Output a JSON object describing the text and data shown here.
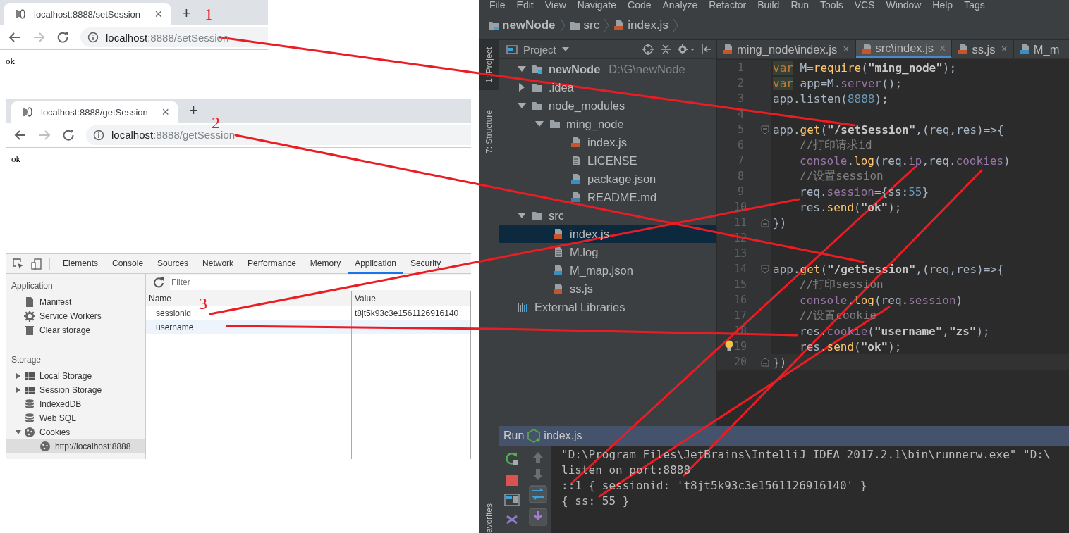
{
  "browsers": [
    {
      "tab": {
        "title": "localhost:8888/setSession",
        "close": "×"
      },
      "new_tab": "+",
      "url": {
        "host": "localhost",
        "rest": ":8888/setSession"
      },
      "content": "ok"
    },
    {
      "tab": {
        "title": "localhost:8888/getSession",
        "close": "×"
      },
      "new_tab": "+",
      "url": {
        "host": "localhost",
        "rest": ":8888/getSession"
      },
      "content": "ok"
    }
  ],
  "annotations": [
    "1",
    "2",
    "3"
  ],
  "devtools": {
    "tabs": [
      {
        "label": "Elements",
        "selected": false
      },
      {
        "label": "Console",
        "selected": false
      },
      {
        "label": "Sources",
        "selected": false
      },
      {
        "label": "Network",
        "selected": false
      },
      {
        "label": "Performance",
        "selected": false
      },
      {
        "label": "Memory",
        "selected": false
      },
      {
        "label": "Application",
        "selected": true
      },
      {
        "label": "Security",
        "selected": false
      }
    ],
    "sidebar": [
      {
        "heading": "Application",
        "items": [
          {
            "label": "Manifest",
            "kind": "manifest",
            "selected": false
          },
          {
            "label": "Service Workers",
            "kind": "gear",
            "selected": false
          },
          {
            "label": "Clear storage",
            "kind": "trash",
            "selected": false
          }
        ]
      },
      {
        "heading": "Storage",
        "items": [
          {
            "label": "Local Storage",
            "kind": "grid",
            "expanded": false,
            "selected": false
          },
          {
            "label": "Session Storage",
            "kind": "grid",
            "expanded": false,
            "selected": false
          },
          {
            "label": "IndexedDB",
            "kind": "database",
            "selected": false
          },
          {
            "label": "Web SQL",
            "kind": "database",
            "selected": false
          },
          {
            "label": "Cookies",
            "kind": "cookie",
            "expanded": true,
            "selected": false,
            "children": [
              {
                "label": "http://localhost:8888",
                "kind": "cookie",
                "selected": true
              }
            ]
          }
        ]
      }
    ],
    "filter": {
      "placeholder": "Filter"
    },
    "table": {
      "columns": [
        "Name",
        "Value"
      ],
      "rows": [
        {
          "name": "sessionid",
          "value": "t8jt5k93c3e1561126916140",
          "selected": false
        },
        {
          "name": "username",
          "selected": true
        }
      ]
    }
  },
  "ide": {
    "menu": [
      "File",
      "Edit",
      "View",
      "Navigate",
      "Code",
      "Analyze",
      "Refactor",
      "Build",
      "Run",
      "Tools",
      "VCS",
      "Window",
      "Help",
      "Tags"
    ],
    "breadcrumbs": [
      {
        "label": "newNode",
        "kind": "module"
      },
      {
        "label": "src",
        "kind": "folder"
      },
      {
        "label": "index.js",
        "kind": "js"
      }
    ],
    "tool_strip": [
      {
        "label": "1: Project",
        "selected": true
      },
      {
        "label": "7: Structure",
        "selected": false
      }
    ],
    "tool_strip_bottom": "avorites",
    "project": {
      "title": "Project",
      "tree": [
        {
          "label": "newNode",
          "path": "D:\\G\\newNode",
          "kind": "module",
          "expanded": true,
          "selected": false,
          "children": [
            {
              "label": ".idea",
              "kind": "folder",
              "expanded": false,
              "selected": false
            },
            {
              "label": "node_modules",
              "kind": "folder",
              "expanded": true,
              "selected": false,
              "children": [
                {
                  "label": "ming_node",
                  "kind": "folder",
                  "expanded": true,
                  "selected": false,
                  "children": [
                    {
                      "label": "index.js",
                      "kind": "js",
                      "selected": false
                    },
                    {
                      "label": "LICENSE",
                      "kind": "text",
                      "selected": false
                    },
                    {
                      "label": "package.json",
                      "kind": "json",
                      "selected": false
                    },
                    {
                      "label": "README.md",
                      "kind": "md",
                      "selected": false
                    }
                  ]
                }
              ]
            },
            {
              "label": "src",
              "kind": "folder",
              "expanded": true,
              "selected": false,
              "children": [
                {
                  "label": "index.js",
                  "kind": "js",
                  "selected": true
                },
                {
                  "label": "M.log",
                  "kind": "text",
                  "selected": false
                },
                {
                  "label": "M_map.json",
                  "kind": "json",
                  "selected": false
                },
                {
                  "label": "ss.js",
                  "kind": "js",
                  "selected": false
                }
              ]
            }
          ]
        },
        {
          "label": "External Libraries",
          "kind": "library",
          "selected": false
        }
      ]
    },
    "editor": {
      "tabs": [
        {
          "label": "ming_node\\index.js",
          "kind": "js",
          "selected": false,
          "close": "×"
        },
        {
          "label": "src\\index.js",
          "kind": "js",
          "selected": true,
          "close": "×"
        },
        {
          "label": "ss.js",
          "kind": "js",
          "selected": false,
          "close": "×"
        },
        {
          "label": "M_m",
          "kind": "json",
          "selected": false
        }
      ],
      "lines": [
        {
          "number": "1",
          "tokens": [
            {
              "kind": "keyword",
              "text": "var"
            },
            {
              "kind": "plain",
              "text": " M="
            },
            {
              "kind": "method",
              "text": "require"
            },
            {
              "kind": "plain",
              "text": "("
            },
            {
              "kind": "string",
              "text": "\"ming_node\""
            },
            {
              "kind": "plain",
              "text": ");"
            }
          ]
        },
        {
          "number": "2",
          "tokens": [
            {
              "kind": "keyword",
              "text": "var"
            },
            {
              "kind": "plain",
              "text": " app=M."
            },
            {
              "kind": "property",
              "text": "server"
            },
            {
              "kind": "plain",
              "text": "();"
            }
          ]
        },
        {
          "number": "3",
          "tokens": [
            {
              "kind": "plain",
              "text": "app.listen("
            },
            {
              "kind": "number",
              "text": "8888"
            },
            {
              "kind": "plain",
              "text": ");"
            }
          ]
        },
        {
          "number": "4"
        },
        {
          "number": "5",
          "fold_start": true,
          "tokens": [
            {
              "kind": "plain",
              "text": "app."
            },
            {
              "kind": "method",
              "text": "get"
            },
            {
              "kind": "plain",
              "text": "("
            },
            {
              "kind": "string",
              "text": "\"/setSession\""
            },
            {
              "kind": "plain",
              "text": ",(req,res)=>{"
            }
          ]
        },
        {
          "number": "6",
          "indented": true,
          "tokens": [
            {
              "kind": "comment",
              "text": "//打印请求id"
            }
          ]
        },
        {
          "number": "7",
          "indented": true,
          "tokens": [
            {
              "kind": "property",
              "text": "console"
            },
            {
              "kind": "plain",
              "text": "."
            },
            {
              "kind": "method",
              "text": "log"
            },
            {
              "kind": "plain",
              "text": "(req."
            },
            {
              "kind": "property",
              "text": "ip"
            },
            {
              "kind": "plain",
              "text": ",req."
            },
            {
              "kind": "property",
              "text": "cookies"
            },
            {
              "kind": "plain",
              "text": ")"
            }
          ]
        },
        {
          "number": "8",
          "indented": true,
          "tokens": [
            {
              "kind": "comment",
              "text": "//设置session"
            }
          ]
        },
        {
          "number": "9",
          "indented": true,
          "tokens": [
            {
              "kind": "plain",
              "text": "req."
            },
            {
              "kind": "property",
              "text": "session"
            },
            {
              "kind": "plain",
              "text": "={ss:"
            },
            {
              "kind": "number",
              "text": "55"
            },
            {
              "kind": "plain",
              "text": "}"
            }
          ]
        },
        {
          "number": "10",
          "indented": true,
          "tokens": [
            {
              "kind": "plain",
              "text": "res."
            },
            {
              "kind": "method",
              "text": "send"
            },
            {
              "kind": "plain",
              "text": "("
            },
            {
              "kind": "string",
              "text": "\"ok\""
            },
            {
              "kind": "plain",
              "text": ");"
            }
          ]
        },
        {
          "number": "11",
          "fold_end": true,
          "tokens": [
            {
              "kind": "plain",
              "text": "})"
            }
          ]
        },
        {
          "number": "12"
        },
        {
          "number": "13"
        },
        {
          "number": "14",
          "fold_start": true,
          "tokens": [
            {
              "kind": "plain",
              "text": "app."
            },
            {
              "kind": "method",
              "text": "get"
            },
            {
              "kind": "plain",
              "text": "("
            },
            {
              "kind": "string",
              "text": "\"/getSession\""
            },
            {
              "kind": "plain",
              "text": ",(req,res)=>{"
            }
          ]
        },
        {
          "number": "15",
          "indented": true,
          "tokens": [
            {
              "kind": "comment",
              "text": "//打印session"
            }
          ]
        },
        {
          "number": "16",
          "indented": true,
          "tokens": [
            {
              "kind": "property",
              "text": "console"
            },
            {
              "kind": "plain",
              "text": "."
            },
            {
              "kind": "method",
              "text": "log"
            },
            {
              "kind": "plain",
              "text": "(req."
            },
            {
              "kind": "property",
              "text": "session"
            },
            {
              "kind": "plain",
              "text": ")"
            }
          ]
        },
        {
          "number": "17",
          "indented": true,
          "tokens": [
            {
              "kind": "comment",
              "text": "//设置cookie"
            }
          ]
        },
        {
          "number": "18",
          "indented": true,
          "tokens": [
            {
              "kind": "plain",
              "text": "res."
            },
            {
              "kind": "property",
              "text": "cookie"
            },
            {
              "kind": "plain",
              "text": "("
            },
            {
              "kind": "string",
              "text": "\"username\""
            },
            {
              "kind": "plain",
              "text": ","
            },
            {
              "kind": "string",
              "text": "\"zs\""
            },
            {
              "kind": "plain",
              "text": ");"
            }
          ]
        },
        {
          "number": "19",
          "bulb": true,
          "indented": true,
          "tokens": [
            {
              "kind": "plain",
              "text": "res."
            },
            {
              "kind": "method",
              "text": "send"
            },
            {
              "kind": "plain",
              "text": "("
            },
            {
              "kind": "string",
              "text": "\"ok\""
            },
            {
              "kind": "plain",
              "text": ");"
            }
          ]
        },
        {
          "number": "20",
          "fold_end": true,
          "current": true,
          "tokens": [
            {
              "kind": "plain",
              "text": "})"
            }
          ]
        }
      ]
    },
    "run": {
      "title": "Run",
      "config": "index.js",
      "console": [
        "\"D:\\Program Files\\JetBrains\\IntelliJ IDEA 2017.2.1\\bin\\runnerw.exe\" \"D:\\",
        "listen on port:8888",
        "::1 { sessionid: 't8jt5k93c3e1561126916140' }",
        "{ ss: 55 }"
      ]
    }
  }
}
